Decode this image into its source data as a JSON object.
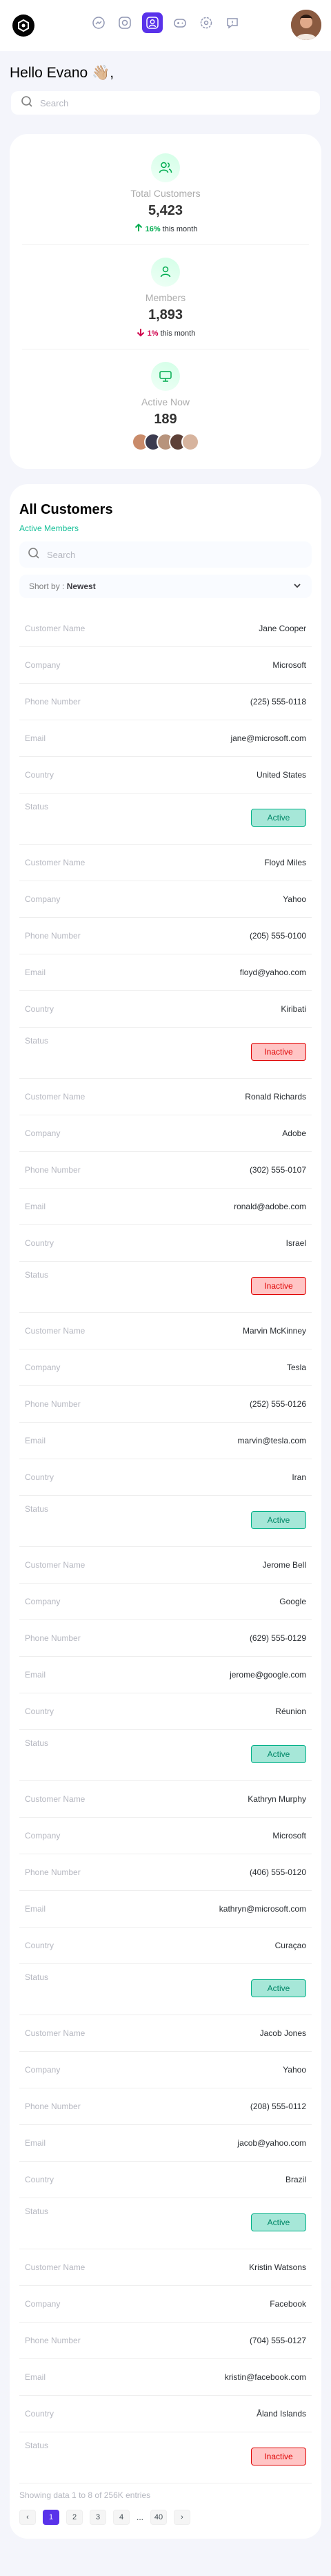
{
  "header": {
    "nav_icons": [
      "chat-icon",
      "camera-icon",
      "user-icon",
      "gamepad-icon",
      "settings-icon",
      "message-icon"
    ],
    "accent": "#5932ea"
  },
  "greeting": "Hello Evano 👋🏼,",
  "search": {
    "placeholder": "Search"
  },
  "stats": [
    {
      "label": "Total Customers",
      "value": "5,423",
      "trend_pct": "16%",
      "trend_text": "this month",
      "trend": "up"
    },
    {
      "label": "Members",
      "value": "1,893",
      "trend_pct": "1%",
      "trend_text": "this month",
      "trend": "down"
    },
    {
      "label": "Active Now",
      "value": "189"
    }
  ],
  "customers": {
    "title": "All Customers",
    "subtitle": "Active Members",
    "search_placeholder": "Search",
    "sort_label": "Short by :",
    "sort_value": "Newest",
    "field_labels": {
      "name": "Customer Name",
      "company": "Company",
      "phone": "Phone Number",
      "email": "Email",
      "country": "Country",
      "status": "Status"
    },
    "records": [
      {
        "name": "Jane Cooper",
        "company": "Microsoft",
        "phone": "(225) 555-0118",
        "email": "jane@microsoft.com",
        "country": "United States",
        "status": "Active"
      },
      {
        "name": "Floyd Miles",
        "company": "Yahoo",
        "phone": "(205) 555-0100",
        "email": "floyd@yahoo.com",
        "country": "Kiribati",
        "status": "Inactive"
      },
      {
        "name": "Ronald Richards",
        "company": "Adobe",
        "phone": "(302) 555-0107",
        "email": "ronald@adobe.com",
        "country": "Israel",
        "status": "Inactive"
      },
      {
        "name": "Marvin McKinney",
        "company": "Tesla",
        "phone": "(252) 555-0126",
        "email": "marvin@tesla.com",
        "country": "Iran",
        "status": "Active"
      },
      {
        "name": "Jerome Bell",
        "company": "Google",
        "phone": "(629) 555-0129",
        "email": "jerome@google.com",
        "country": "Réunion",
        "status": "Active"
      },
      {
        "name": "Kathryn Murphy",
        "company": "Microsoft",
        "phone": "(406) 555-0120",
        "email": "kathryn@microsoft.com",
        "country": "Curaçao",
        "status": "Active"
      },
      {
        "name": "Jacob Jones",
        "company": "Yahoo",
        "phone": "(208) 555-0112",
        "email": "jacob@yahoo.com",
        "country": "Brazil",
        "status": "Active"
      },
      {
        "name": "Kristin Watsons",
        "company": "Facebook",
        "phone": "(704) 555-0127",
        "email": "kristin@facebook.com",
        "country": "Åland Islands",
        "status": "Inactive"
      }
    ],
    "footer": "Showing data 1 to 8 of 256K entries",
    "pages": [
      "1",
      "2",
      "3",
      "4",
      "...",
      "40"
    ],
    "prev": "‹",
    "next": "›",
    "current_page": "1"
  }
}
